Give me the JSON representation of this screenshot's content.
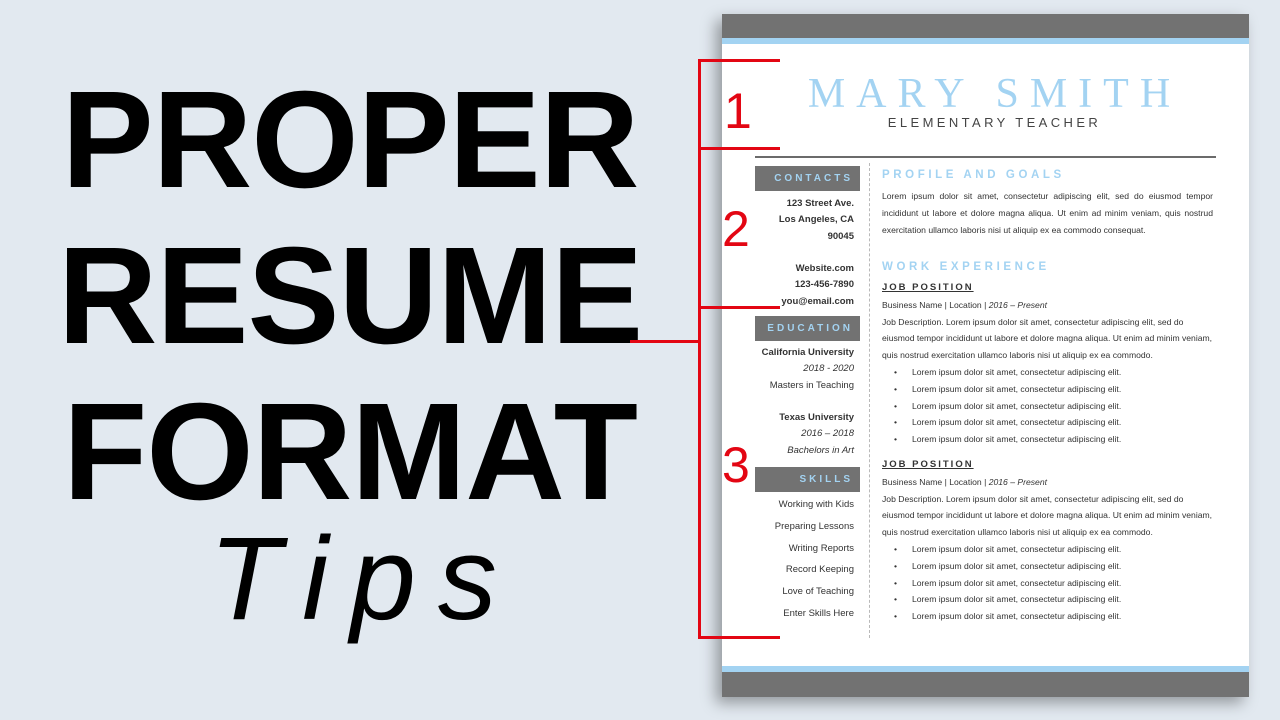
{
  "headline": {
    "line1": "PROPER",
    "line2": "RESUME",
    "line3": "FORMAT",
    "line4": "Tips"
  },
  "annotations": {
    "numbers": [
      "1",
      "2",
      "3"
    ],
    "color": "#e30613"
  },
  "colors": {
    "accent_blue": "#a3d3f2",
    "bar_gray": "#727272",
    "background": "#e2e9f0"
  },
  "resume": {
    "name": "MARY SMITH",
    "title": "ELEMENTARY TEACHER",
    "sidebar": {
      "contacts_heading": "CONTACTS",
      "address": [
        "123 Street Ave.",
        "Los Angeles, CA",
        "90045"
      ],
      "contact": [
        "Website.com",
        "123-456-7890",
        "you@email.com"
      ],
      "education_heading": "EDUCATION",
      "education": [
        {
          "school": "California University",
          "years": "2018 - 2020",
          "degree": "Masters in Teaching"
        },
        {
          "school": "Texas University",
          "years": "2016 – 2018",
          "degree": "Bachelors in Art"
        }
      ],
      "skills_heading": "SKILLS",
      "skills": [
        "Working with Kids",
        "Preparing Lessons",
        "Writing Reports",
        "Record Keeping",
        "Love of Teaching",
        "Enter Skills Here"
      ]
    },
    "main": {
      "profile_heading": "PROFILE AND GOALS",
      "profile_text": "Lorem ipsum dolor sit amet, consectetur adipiscing elit, sed do eiusmod tempor incididunt ut labore et dolore magna aliqua. Ut enim ad minim veniam, quis nostrud exercitation ullamco laboris nisi ut aliquip ex ea commodo consequat.",
      "work_heading": "WORK EXPERIENCE",
      "jobs": [
        {
          "position": "JOB POSITION",
          "meta": "Business Name | Location | ",
          "dates": "2016 – Present",
          "description": "Job Description. Lorem ipsum dolor sit amet, consectetur adipiscing elit, sed do eiusmod tempor incididunt ut labore et dolore magna aliqua. Ut enim ad minim veniam, quis nostrud exercitation ullamco laboris nisi ut aliquip ex ea commodo.",
          "bullets": [
            "Lorem ipsum dolor sit amet, consectetur adipiscing elit.",
            "Lorem ipsum dolor sit amet, consectetur adipiscing elit.",
            "Lorem ipsum dolor sit amet, consectetur adipiscing elit.",
            "Lorem ipsum dolor sit amet, consectetur adipiscing elit.",
            "Lorem ipsum dolor sit amet, consectetur adipiscing elit."
          ]
        },
        {
          "position": "JOB POSITION",
          "meta": "Business Name | Location | ",
          "dates": "2016 – Present",
          "description": "Job Description. Lorem ipsum dolor sit amet, consectetur adipiscing elit, sed do eiusmod tempor incididunt ut labore et dolore magna aliqua. Ut enim ad minim veniam, quis nostrud exercitation ullamco laboris nisi ut aliquip ex ea commodo.",
          "bullets": [
            "Lorem ipsum dolor sit amet, consectetur adipiscing elit.",
            "Lorem ipsum dolor sit amet, consectetur adipiscing elit.",
            "Lorem ipsum dolor sit amet, consectetur adipiscing elit.",
            "Lorem ipsum dolor sit amet, consectetur adipiscing elit.",
            "Lorem ipsum dolor sit amet, consectetur adipiscing elit."
          ]
        }
      ]
    }
  }
}
